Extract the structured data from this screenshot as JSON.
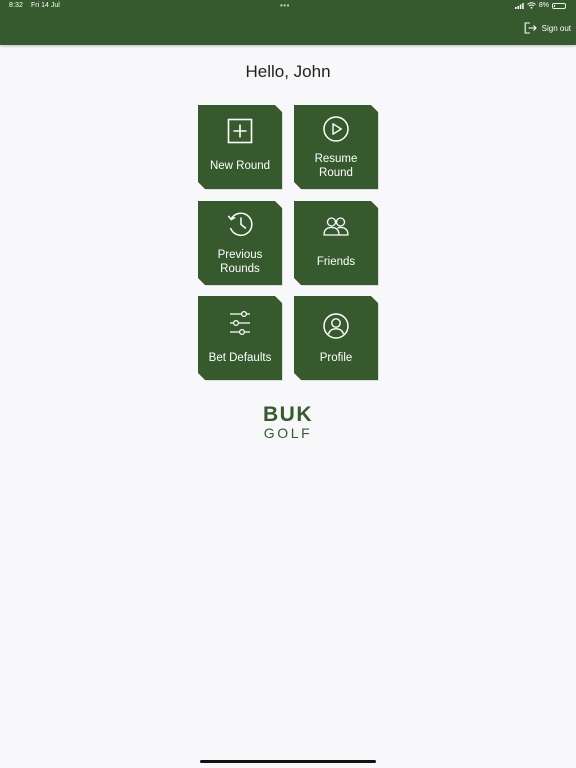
{
  "status_bar": {
    "time": "8:32",
    "date": "Fri 14 Jul",
    "battery": "8%",
    "icons": [
      "signal-icon",
      "wifi-icon",
      "battery-icon"
    ]
  },
  "header": {
    "sign_out_label": "Sign out",
    "sign_out_icon": "logout-icon"
  },
  "greeting": "Hello, John",
  "tiles": [
    {
      "label": "New Round",
      "icon": "plus-square-icon"
    },
    {
      "label": "Resume Round",
      "icon": "play-circle-icon"
    },
    {
      "label": "Previous Rounds",
      "icon": "history-clock-icon"
    },
    {
      "label": "Friends",
      "icon": "friends-icon"
    },
    {
      "label": "Bet Defaults",
      "icon": "sliders-icon"
    },
    {
      "label": "Profile",
      "icon": "user-circle-icon"
    }
  ],
  "logo": {
    "primary": "BUK",
    "secondary": "GOLF"
  },
  "colors": {
    "brand": "#36592e",
    "background": "#f8f8fa",
    "text": "#222222"
  }
}
